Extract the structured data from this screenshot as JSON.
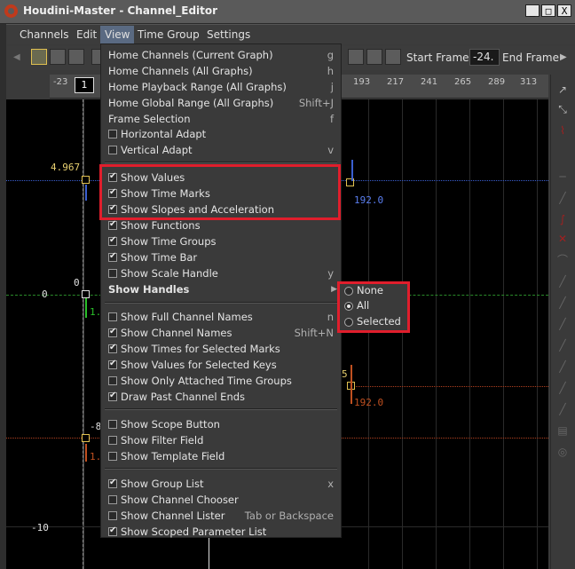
{
  "window": {
    "title": "Houdini-Master - Channel_Editor",
    "buttons": [
      "_",
      "□",
      "X"
    ]
  },
  "menubar": {
    "items": [
      "Channels",
      "Edit",
      "View",
      "Time Group",
      "Settings"
    ]
  },
  "toolbar": {
    "start_frame_label": "Start Frame",
    "start_frame_value": "-24.",
    "end_frame_label": "End Frame"
  },
  "ruler": {
    "marker": "1",
    "ticks": [
      "-23",
      "193",
      "217",
      "241",
      "265",
      "289",
      "313"
    ]
  },
  "graph": {
    "y_labels": [
      "0",
      "-10"
    ],
    "value_labels": [
      "4.967",
      "0",
      "-8",
      "8",
      "5",
      "1.",
      "1."
    ],
    "time_labels": [
      "192.0",
      "192.0"
    ]
  },
  "view_menu": {
    "items": [
      {
        "label": "Home Channels (Current Graph)",
        "shortcut": "g"
      },
      {
        "label": "Home Channels (All Graphs)",
        "shortcut": "h"
      },
      {
        "label": "Home Playback Range (All Graphs)",
        "shortcut": "j"
      },
      {
        "label": "Home Global Range (All Graphs)",
        "shortcut": "Shift+J"
      },
      {
        "label": "Frame Selection",
        "shortcut": "f"
      }
    ],
    "adapt": [
      {
        "label": "Horizontal Adapt",
        "checked": false,
        "shortcut": ""
      },
      {
        "label": "Vertical Adapt",
        "checked": false,
        "shortcut": "v"
      }
    ],
    "show1": [
      {
        "label": "Show Values",
        "checked": true,
        "shortcut": ""
      },
      {
        "label": "Show Time Marks",
        "checked": true,
        "shortcut": ""
      },
      {
        "label": "Show Slopes and Acceleration",
        "checked": true,
        "shortcut": ""
      },
      {
        "label": "Show Functions",
        "checked": true,
        "shortcut": ""
      },
      {
        "label": "Show Time Groups",
        "checked": true,
        "shortcut": ""
      },
      {
        "label": "Show Time Bar",
        "checked": true,
        "shortcut": ""
      },
      {
        "label": "Show Scale Handle",
        "checked": false,
        "shortcut": "y"
      }
    ],
    "show_handles": "Show Handles",
    "show2": [
      {
        "label": "Show Full Channel Names",
        "checked": false,
        "shortcut": "n"
      },
      {
        "label": "Show Channel Names",
        "checked": true,
        "shortcut": "Shift+N"
      },
      {
        "label": "Show Times for Selected Marks",
        "checked": true,
        "shortcut": ""
      },
      {
        "label": "Show Values for Selected Keys",
        "checked": true,
        "shortcut": ""
      },
      {
        "label": "Show Only Attached Time Groups",
        "checked": false,
        "shortcut": ""
      },
      {
        "label": "Draw Past Channel Ends",
        "checked": true,
        "shortcut": ""
      }
    ],
    "show3": [
      {
        "label": "Show Scope Button",
        "checked": false,
        "shortcut": ""
      },
      {
        "label": "Show Filter Field",
        "checked": false,
        "shortcut": ""
      },
      {
        "label": "Show Template Field",
        "checked": false,
        "shortcut": ""
      }
    ],
    "show4": [
      {
        "label": "Show Group List",
        "checked": true,
        "shortcut": "x"
      },
      {
        "label": "Show Channel Chooser",
        "checked": false,
        "shortcut": ""
      },
      {
        "label": "Show Channel Lister",
        "checked": false,
        "shortcut": "Tab or Backspace"
      },
      {
        "label": "Show Scoped Parameter List",
        "checked": true,
        "shortcut": ""
      }
    ]
  },
  "handles_submenu": {
    "options": [
      {
        "label": "None",
        "selected": false
      },
      {
        "label": "All",
        "selected": true
      },
      {
        "label": "Selected",
        "selected": false
      }
    ]
  },
  "colors": {
    "highlight": "#e01e2c",
    "menu_bg": "#3a3a3a",
    "key_yellow": "#e0c050"
  }
}
